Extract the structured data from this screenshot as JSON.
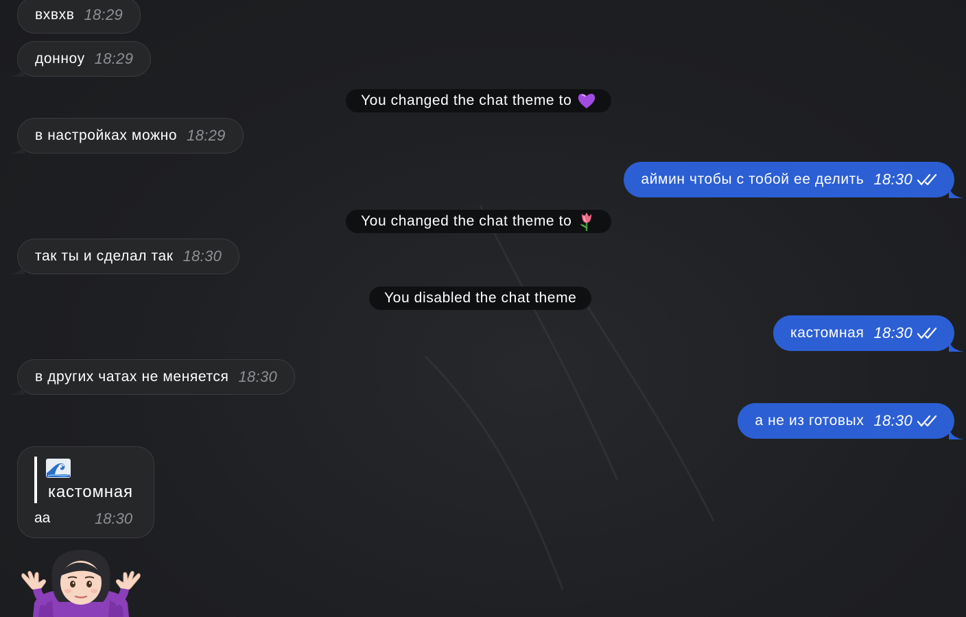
{
  "messages": [
    {
      "id": "m1",
      "direction": "incoming",
      "text": "вхвхв",
      "time": "18:29"
    },
    {
      "id": "m2",
      "direction": "incoming",
      "text": "донноу",
      "time": "18:29"
    },
    {
      "id": "s1",
      "type": "service",
      "text": "You changed the chat theme to",
      "emoji": "purple-heart-icon"
    },
    {
      "id": "m3",
      "direction": "incoming",
      "text": "в настройках можно",
      "time": "18:29"
    },
    {
      "id": "m4",
      "direction": "outgoing",
      "text": "аймин чтобы с тобой ее делить",
      "time": "18:30",
      "status": "read"
    },
    {
      "id": "s2",
      "type": "service",
      "text": "You changed the chat theme to",
      "emoji": "tulip-icon"
    },
    {
      "id": "m5",
      "direction": "incoming",
      "text": "так ты и сделал так",
      "time": "18:30"
    },
    {
      "id": "s3",
      "type": "service",
      "text": "You disabled the chat theme"
    },
    {
      "id": "m6",
      "direction": "outgoing",
      "text": "кастомная",
      "time": "18:30",
      "status": "read"
    },
    {
      "id": "m7",
      "direction": "incoming",
      "text": "в других чатах не меняется",
      "time": "18:30"
    },
    {
      "id": "m8",
      "direction": "outgoing",
      "text": "а не из готовых",
      "time": "18:30",
      "status": "read"
    },
    {
      "id": "m9",
      "direction": "incoming",
      "reply_to": {
        "emoji": "wave-icon",
        "text": "кастомная"
      },
      "text": "аа",
      "time": "18:30"
    },
    {
      "id": "m10",
      "direction": "incoming",
      "type": "sticker",
      "sticker": "woman-shrugging-icon"
    }
  ],
  "colors": {
    "background": "#1e1f22",
    "incoming_bubble": "#262729",
    "outgoing_bubble": "#2c5fd4",
    "service_pill": "#0f1012",
    "time_incoming": "#8e9094"
  }
}
